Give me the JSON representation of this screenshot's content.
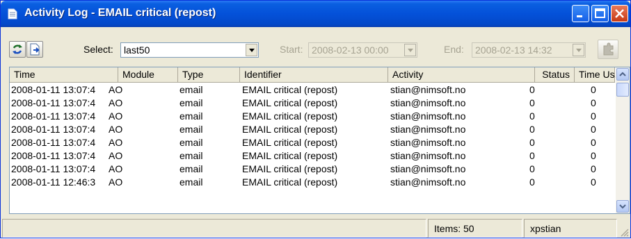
{
  "window": {
    "title": "Activity Log - EMAIL critical (repost)"
  },
  "toolbar": {
    "select_label": "Select:",
    "select_value": "last50",
    "start_label": "Start:",
    "start_value": "2008-02-13 00:00",
    "end_label": "End:",
    "end_value": "2008-02-13 14:32"
  },
  "table": {
    "columns": [
      "Time",
      "Module",
      "Type",
      "Identifier",
      "Activity",
      "Status",
      "Time Us..."
    ],
    "rows": [
      [
        "2008-01-11 13:07:4",
        "AO",
        "email",
        "EMAIL critical (repost)",
        "stian@nimsoft.no",
        "0",
        "0"
      ],
      [
        "2008-01-11 13:07:4",
        "AO",
        "email",
        "EMAIL critical (repost)",
        "stian@nimsoft.no",
        "0",
        "0"
      ],
      [
        "2008-01-11 13:07:4",
        "AO",
        "email",
        "EMAIL critical (repost)",
        "stian@nimsoft.no",
        "0",
        "0"
      ],
      [
        "2008-01-11 13:07:4",
        "AO",
        "email",
        "EMAIL critical (repost)",
        "stian@nimsoft.no",
        "0",
        "0"
      ],
      [
        "2008-01-11 13:07:4",
        "AO",
        "email",
        "EMAIL critical (repost)",
        "stian@nimsoft.no",
        "0",
        "0"
      ],
      [
        "2008-01-11 13:07:4",
        "AO",
        "email",
        "EMAIL critical (repost)",
        "stian@nimsoft.no",
        "0",
        "0"
      ],
      [
        "2008-01-11 13:07:4",
        "AO",
        "email",
        "EMAIL critical (repost)",
        "stian@nimsoft.no",
        "0",
        "0"
      ],
      [
        "2008-01-11 12:46:3",
        "AO",
        "email",
        "EMAIL critical (repost)",
        "stian@nimsoft.no",
        "0",
        "0"
      ]
    ]
  },
  "status": {
    "items": "Items: 50",
    "user": "xpstian"
  },
  "icons": {
    "refresh": "refresh-icon",
    "export": "export-icon",
    "disabled_action": "puzzle-icon"
  },
  "colors": {
    "titlebar": "#0451d9",
    "chrome": "#ece9d8",
    "close": "#c73a14"
  }
}
